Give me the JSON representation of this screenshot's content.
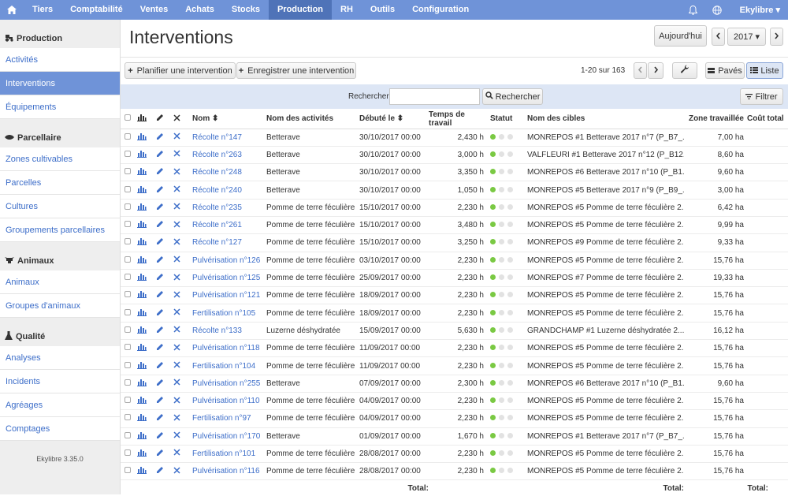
{
  "nav": {
    "items": [
      {
        "label": "Tiers",
        "active": false
      },
      {
        "label": "Comptabilité",
        "active": false
      },
      {
        "label": "Ventes",
        "active": false
      },
      {
        "label": "Achats",
        "active": false
      },
      {
        "label": "Stocks",
        "active": false
      },
      {
        "label": "Production",
        "active": true
      },
      {
        "label": "RH",
        "active": false
      },
      {
        "label": "Outils",
        "active": false
      },
      {
        "label": "Configuration",
        "active": false
      }
    ],
    "user": "Ekylibre ▾"
  },
  "sidebar": {
    "sections": [
      {
        "title": "Production",
        "icon": "tractor-icon",
        "items": [
          "Activités",
          "Interventions",
          "Équipements"
        ]
      },
      {
        "title": "Parcellaire",
        "icon": "leaf-icon",
        "items": [
          "Zones cultivables",
          "Parcelles",
          "Cultures",
          "Groupements parcellaires"
        ]
      },
      {
        "title": "Animaux",
        "icon": "cow-icon",
        "items": [
          "Animaux",
          "Groupes d'animaux"
        ]
      },
      {
        "title": "Qualité",
        "icon": "flask-icon",
        "items": [
          "Analyses",
          "Incidents",
          "Agréages",
          "Comptages"
        ]
      }
    ],
    "active_item": "Interventions",
    "version": "Ekylibre 3.35.0"
  },
  "header": {
    "title": "Interventions",
    "today_label": "Aujourd'hui",
    "year": "2017 ▾"
  },
  "toolbar": {
    "plan_label": "Planifier une intervention",
    "record_label": "Enregistrer une intervention",
    "pagination": "1-20 sur 163",
    "paves_label": "Pavés",
    "liste_label": "Liste"
  },
  "search": {
    "label": "Rechercher",
    "value": "",
    "button_label": "Rechercher",
    "filter_label": "Filtrer"
  },
  "table": {
    "columns": [
      "Nom ⬍",
      "Nom des activités",
      "Débuté le ⬍",
      "Temps de travail",
      "Statut",
      "Nom des cibles",
      "Zone travaillée",
      "Coût total"
    ],
    "rows": [
      {
        "nom": "Récolte n°147",
        "activite": "Betterave",
        "debut": "30/10/2017 00:00",
        "temps": "2,430 h",
        "cibles": "MONREPOS #1 Betterave 2017 n°7 (P_B7_...",
        "zone": "7,00 ha"
      },
      {
        "nom": "Récolte n°263",
        "activite": "Betterave",
        "debut": "30/10/2017 00:00",
        "temps": "3,000 h",
        "cibles": "VALFLEURI #1 Betterave 2017 n°12 (P_B12...",
        "zone": "8,60 ha"
      },
      {
        "nom": "Récolte n°248",
        "activite": "Betterave",
        "debut": "30/10/2017 00:00",
        "temps": "3,350 h",
        "cibles": "MONREPOS #6 Betterave 2017 n°10 (P_B1...",
        "zone": "9,60 ha"
      },
      {
        "nom": "Récolte n°240",
        "activite": "Betterave",
        "debut": "30/10/2017 00:00",
        "temps": "1,050 h",
        "cibles": "MONREPOS #5 Betterave 2017 n°9 (P_B9_...",
        "zone": "3,00 ha"
      },
      {
        "nom": "Récolte n°235",
        "activite": "Pomme de terre féculière",
        "debut": "15/10/2017 00:00",
        "temps": "2,230 h",
        "cibles": "MONREPOS #5 Pomme de terre féculière 2...",
        "zone": "6,42 ha"
      },
      {
        "nom": "Récolte n°261",
        "activite": "Pomme de terre féculière",
        "debut": "15/10/2017 00:00",
        "temps": "3,480 h",
        "cibles": "MONREPOS #5 Pomme de terre féculière 2...",
        "zone": "9,99 ha"
      },
      {
        "nom": "Récolte n°127",
        "activite": "Pomme de terre féculière",
        "debut": "15/10/2017 00:00",
        "temps": "3,250 h",
        "cibles": "MONREPOS #9 Pomme de terre féculière 2...",
        "zone": "9,33 ha"
      },
      {
        "nom": "Pulvérisation n°126",
        "activite": "Pomme de terre féculière",
        "debut": "03/10/2017 00:00",
        "temps": "2,230 h",
        "cibles": "MONREPOS #5 Pomme de terre féculière 2...",
        "zone": "15,76 ha"
      },
      {
        "nom": "Pulvérisation n°125",
        "activite": "Pomme de terre féculière",
        "debut": "25/09/2017 00:00",
        "temps": "2,230 h",
        "cibles": "MONREPOS #7 Pomme de terre féculière 2...",
        "zone": "19,33 ha"
      },
      {
        "nom": "Pulvérisation n°121",
        "activite": "Pomme de terre féculière",
        "debut": "18/09/2017 00:00",
        "temps": "2,230 h",
        "cibles": "MONREPOS #5 Pomme de terre féculière 2...",
        "zone": "15,76 ha"
      },
      {
        "nom": "Fertilisation n°105",
        "activite": "Pomme de terre féculière",
        "debut": "18/09/2017 00:00",
        "temps": "2,230 h",
        "cibles": "MONREPOS #5 Pomme de terre féculière 2...",
        "zone": "15,76 ha"
      },
      {
        "nom": "Récolte n°133",
        "activite": "Luzerne déshydratée",
        "debut": "15/09/2017 00:00",
        "temps": "5,630 h",
        "cibles": "GRANDCHAMP #1 Luzerne déshydratée 2...",
        "zone": "16,12 ha"
      },
      {
        "nom": "Pulvérisation n°118",
        "activite": "Pomme de terre féculière",
        "debut": "11/09/2017 00:00",
        "temps": "2,230 h",
        "cibles": "MONREPOS #5 Pomme de terre féculière 2...",
        "zone": "15,76 ha"
      },
      {
        "nom": "Fertilisation n°104",
        "activite": "Pomme de terre féculière",
        "debut": "11/09/2017 00:00",
        "temps": "2,230 h",
        "cibles": "MONREPOS #5 Pomme de terre féculière 2...",
        "zone": "15,76 ha"
      },
      {
        "nom": "Pulvérisation n°255",
        "activite": "Betterave",
        "debut": "07/09/2017 00:00",
        "temps": "2,300 h",
        "cibles": "MONREPOS #6 Betterave 2017 n°10 (P_B1...",
        "zone": "9,60 ha"
      },
      {
        "nom": "Pulvérisation n°110",
        "activite": "Pomme de terre féculière",
        "debut": "04/09/2017 00:00",
        "temps": "2,230 h",
        "cibles": "MONREPOS #5 Pomme de terre féculière 2...",
        "zone": "15,76 ha"
      },
      {
        "nom": "Fertilisation n°97",
        "activite": "Pomme de terre féculière",
        "debut": "04/09/2017 00:00",
        "temps": "2,230 h",
        "cibles": "MONREPOS #5 Pomme de terre féculière 2...",
        "zone": "15,76 ha"
      },
      {
        "nom": "Pulvérisation n°170",
        "activite": "Betterave",
        "debut": "01/09/2017 00:00",
        "temps": "1,670 h",
        "cibles": "MONREPOS #1 Betterave 2017 n°7 (P_B7_...",
        "zone": "15,76 ha"
      },
      {
        "nom": "Fertilisation n°101",
        "activite": "Pomme de terre féculière",
        "debut": "28/08/2017 00:00",
        "temps": "2,230 h",
        "cibles": "MONREPOS #5 Pomme de terre féculière 2...",
        "zone": "15,76 ha"
      },
      {
        "nom": "Pulvérisation n°116",
        "activite": "Pomme de terre féculière",
        "debut": "28/08/2017 00:00",
        "temps": "2,230 h",
        "cibles": "MONREPOS #5 Pomme de terre féculière 2...",
        "zone": "15,76 ha"
      }
    ],
    "total_label": "Total:"
  },
  "colors": {
    "nav_bg": "#6f93d8",
    "nav_active": "#4f73b8",
    "link": "#3d6ec9",
    "status_done": "#7ac943"
  }
}
